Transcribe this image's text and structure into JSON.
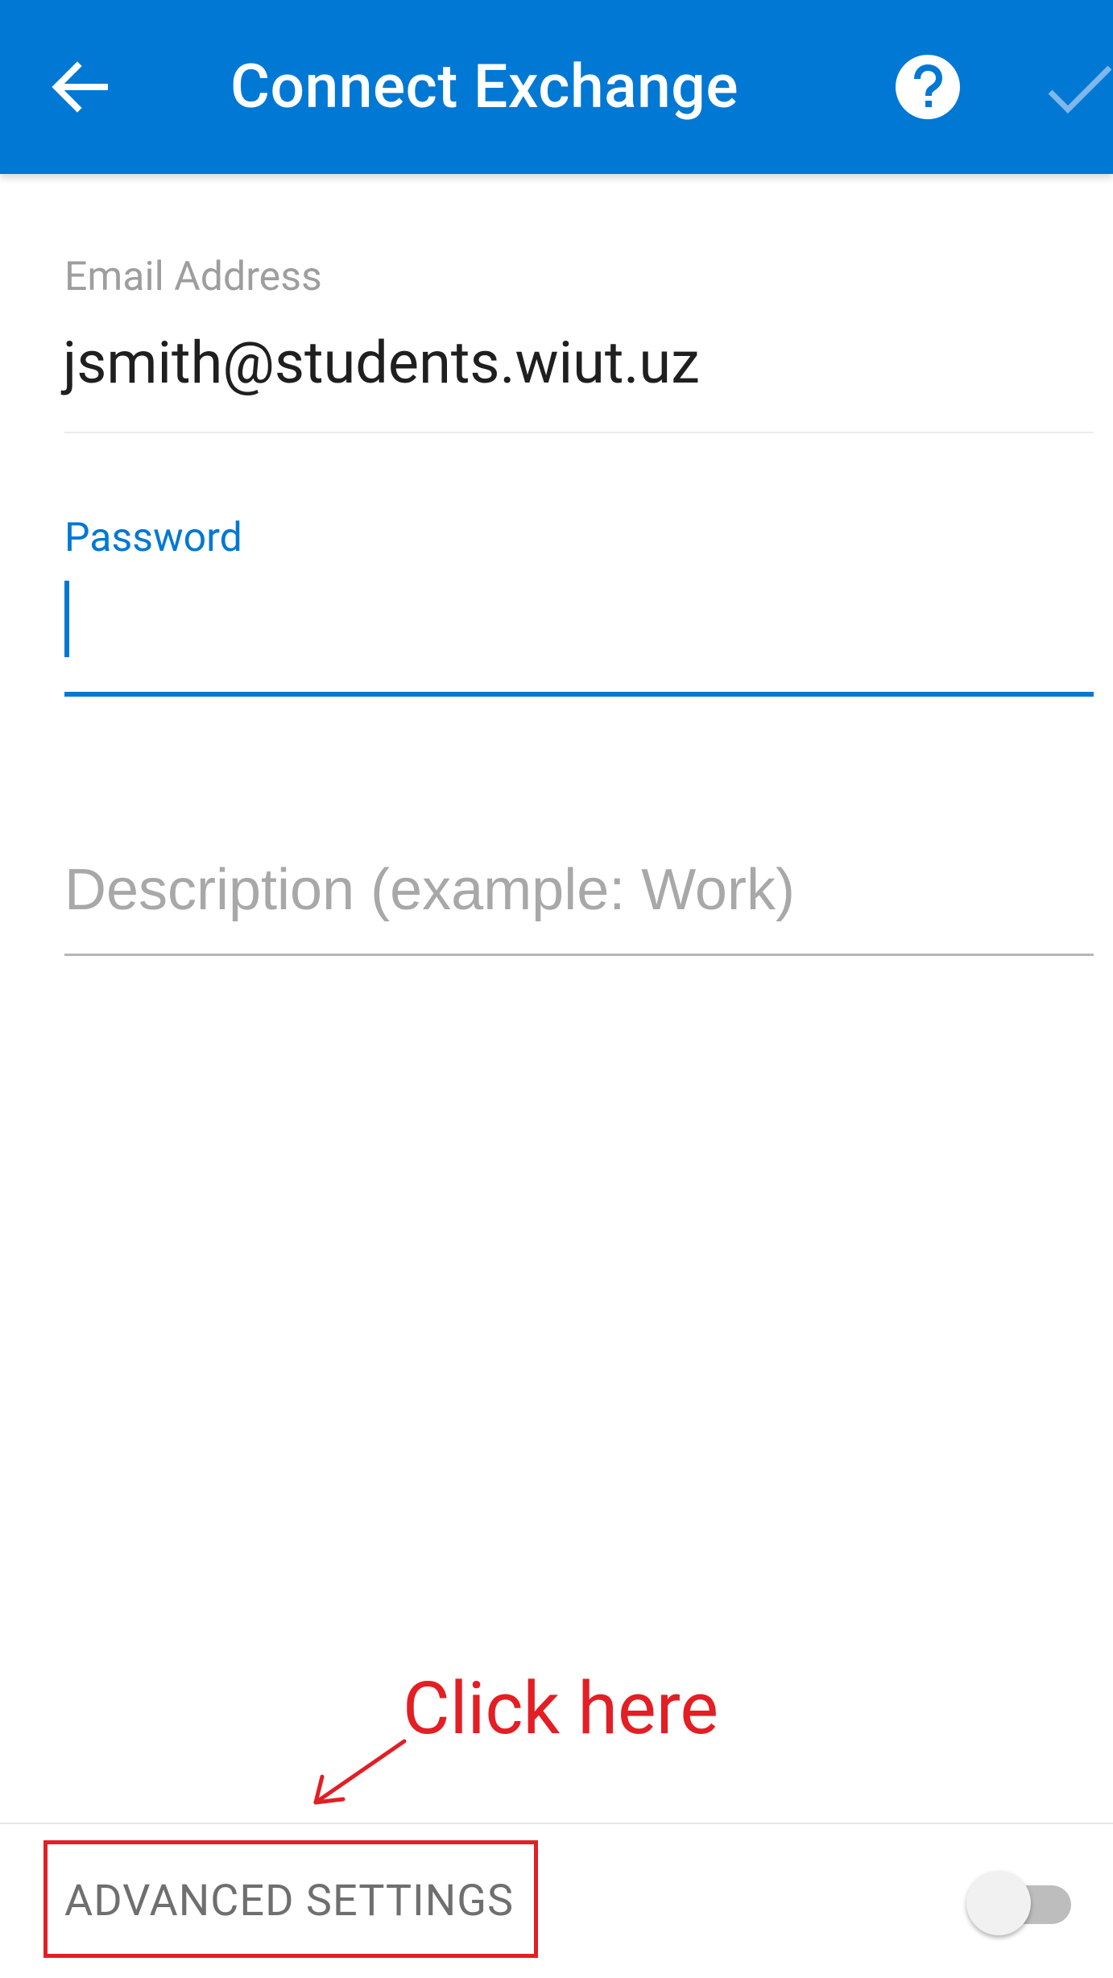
{
  "app_bar": {
    "title": "Connect Exchange",
    "back_icon": "arrow-left-icon",
    "help_icon": "question-circle-icon",
    "confirm_icon": "checkmark-icon",
    "color": "#0078d4"
  },
  "form": {
    "email": {
      "label": "Email Address",
      "value": "jsmith@students.wiut.uz"
    },
    "password": {
      "label": "Password",
      "value": ""
    },
    "description": {
      "placeholder": "Description (example: Work)",
      "value": ""
    }
  },
  "annotation": {
    "text": "Click here",
    "color": "#e31e24"
  },
  "advanced_settings": {
    "label": "ADVANCED SETTINGS",
    "enabled": false
  }
}
